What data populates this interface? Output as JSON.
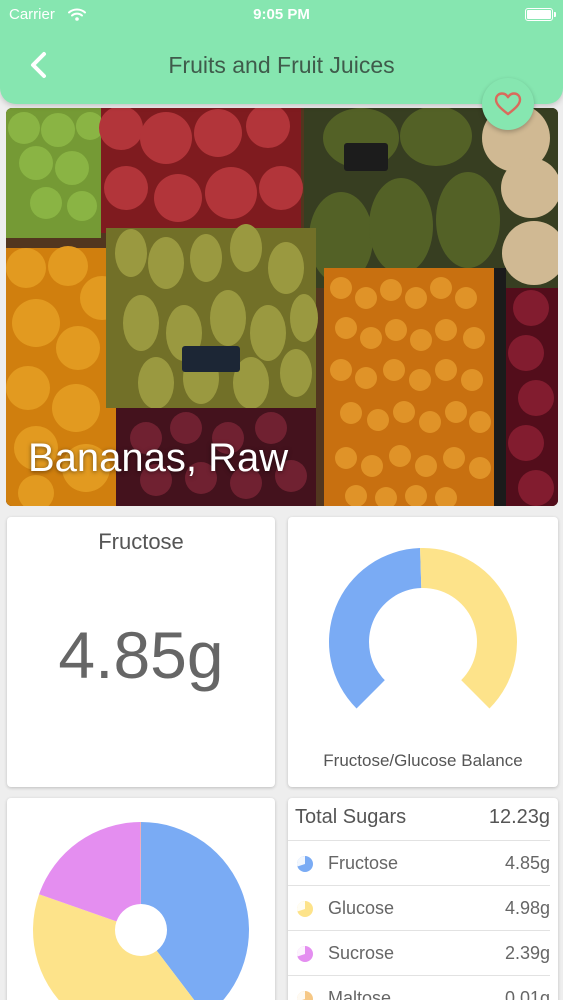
{
  "status_bar": {
    "carrier": "Carrier",
    "time": "9:05 PM"
  },
  "header": {
    "title": "Fruits and Fruit Juices"
  },
  "hero": {
    "food_name": "Bananas, Raw"
  },
  "fructose_card": {
    "label": "Fructose",
    "value": "4.85g"
  },
  "balance_card": {
    "label": "Fructose/Glucose Balance"
  },
  "sugars": {
    "total_label": "Total Sugars",
    "total_value": "12.23g",
    "items": [
      {
        "name": "Fructose",
        "value": "4.85g",
        "color": "#7aabf4"
      },
      {
        "name": "Glucose",
        "value": "4.98g",
        "color": "#fde38a"
      },
      {
        "name": "Sucrose",
        "value": "2.39g",
        "color": "#e48ef0"
      },
      {
        "name": "Maltose",
        "value": "0.01g",
        "color": "#f6c886"
      }
    ]
  },
  "chart_data": [
    {
      "type": "pie",
      "chart_role": "gauge-donut",
      "categories": [
        "Fructose",
        "Glucose"
      ],
      "values": [
        4.85,
        4.98
      ]
    },
    {
      "type": "pie",
      "chart_role": "donut",
      "categories": [
        "Fructose",
        "Glucose",
        "Sucrose",
        "Maltose"
      ],
      "values": [
        4.85,
        4.98,
        2.39,
        0.01
      ]
    }
  ],
  "colors": {
    "header": "#86e6b0",
    "fructose": "#7aabf4",
    "glucose": "#fde38a",
    "sucrose": "#e48ef0",
    "maltose": "#f6c886"
  }
}
